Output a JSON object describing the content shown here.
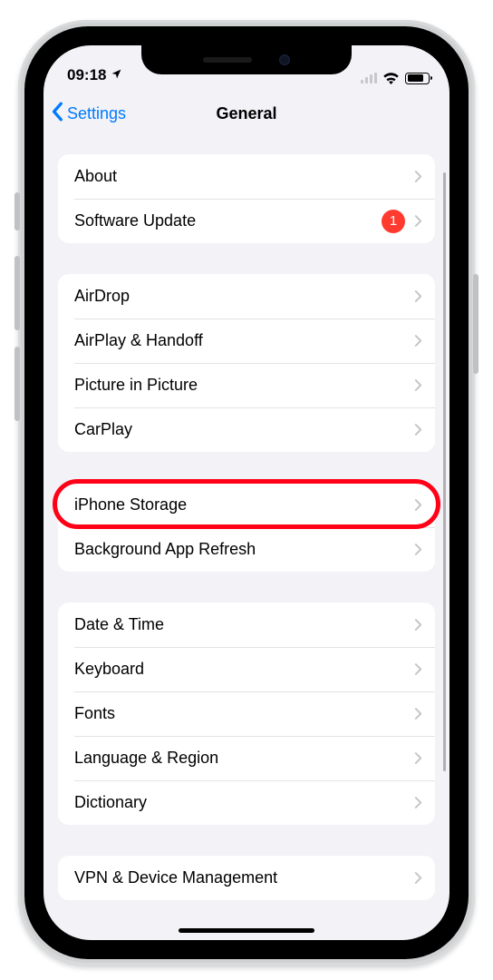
{
  "statusbar": {
    "time": "09:18"
  },
  "nav": {
    "back": "Settings",
    "title": "General"
  },
  "groups": [
    {
      "rows": [
        {
          "key": "about",
          "label": "About"
        },
        {
          "key": "software-update",
          "label": "Software Update",
          "badge": "1"
        }
      ]
    },
    {
      "rows": [
        {
          "key": "airdrop",
          "label": "AirDrop"
        },
        {
          "key": "airplay-handoff",
          "label": "AirPlay & Handoff"
        },
        {
          "key": "picture-in-picture",
          "label": "Picture in Picture"
        },
        {
          "key": "carplay",
          "label": "CarPlay"
        }
      ]
    },
    {
      "rows": [
        {
          "key": "iphone-storage",
          "label": "iPhone Storage",
          "highlighted": true
        },
        {
          "key": "background-app-refresh",
          "label": "Background App Refresh"
        }
      ]
    },
    {
      "rows": [
        {
          "key": "date-time",
          "label": "Date & Time"
        },
        {
          "key": "keyboard",
          "label": "Keyboard"
        },
        {
          "key": "fonts",
          "label": "Fonts"
        },
        {
          "key": "language-region",
          "label": "Language & Region"
        },
        {
          "key": "dictionary",
          "label": "Dictionary"
        }
      ]
    },
    {
      "rows": [
        {
          "key": "vpn-device-management",
          "label": "VPN & Device Management"
        }
      ]
    }
  ]
}
